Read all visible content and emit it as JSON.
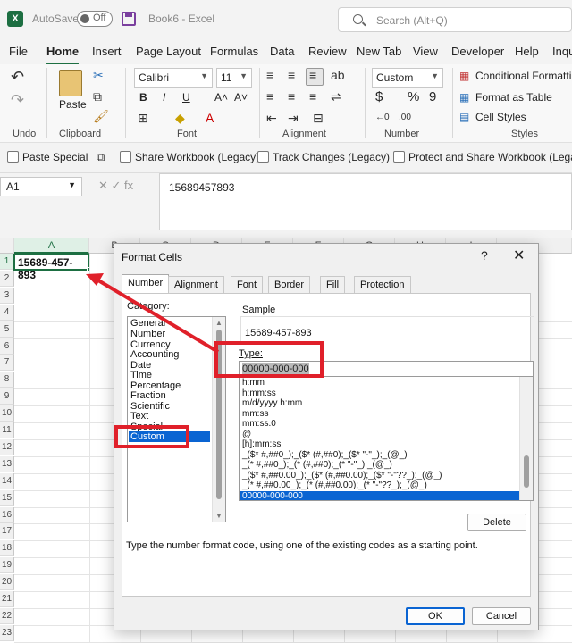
{
  "titlebar": {
    "logo": "X",
    "autosave_label": "AutoSave",
    "autosave_state": "Off",
    "document_title": "Book6  -  Excel",
    "search_placeholder": "Search (Alt+Q)"
  },
  "ribbon_tabs": [
    "File",
    "Home",
    "Insert",
    "Page Layout",
    "Formulas",
    "Data",
    "Review",
    "New Tab",
    "View",
    "Developer",
    "Help",
    "Inqu"
  ],
  "ribbon": {
    "groups": {
      "undo": "Undo",
      "clipboard": "Clipboard",
      "font": "Font",
      "alignment": "Alignment",
      "number": "Number",
      "styles": "Styles"
    },
    "paste_label": "Paste",
    "font_name": "Calibri",
    "font_size": "11",
    "number_format": "Custom",
    "conditional_formatting": "Conditional Formatting",
    "format_as_table": "Format as Table",
    "cell_styles": "Cell Styles",
    "bold": "B",
    "italic": "I",
    "underline": "U",
    "font_grow": "A˄",
    "font_shrink": "A˅",
    "currency": "$",
    "percent": "%",
    "comma": "9"
  },
  "quick_access": [
    "Paste Special",
    "Share Workbook (Legacy)",
    "Track Changes (Legacy)",
    "Protect and Share Workbook (Legacy)"
  ],
  "formula_bar": {
    "name_box": "A1",
    "icons": "✕  ✓  fx",
    "value": "15689457893"
  },
  "grid": {
    "columns": [
      "A",
      "B",
      "C",
      "D",
      "E",
      "F",
      "G",
      "H",
      "I"
    ],
    "rows": [
      "1",
      "2",
      "3",
      "4",
      "5",
      "6",
      "7",
      "8",
      "9",
      "10",
      "11",
      "12",
      "13",
      "14",
      "15",
      "16",
      "17",
      "18",
      "19",
      "20",
      "21",
      "22",
      "23"
    ],
    "a1_display": "15689-457-893"
  },
  "dialog": {
    "title": "Format Cells",
    "help": "?",
    "close": "✕",
    "tabs": [
      "Number",
      "Alignment",
      "Font",
      "Border",
      "Fill",
      "Protection"
    ],
    "category_label": "Category:",
    "categories": [
      "General",
      "Number",
      "Currency",
      "Accounting",
      "Date",
      "Time",
      "Percentage",
      "Fraction",
      "Scientific",
      "Text",
      "Special",
      "Custom"
    ],
    "selected_category": "Custom",
    "sample_label": "Sample",
    "sample_value": "15689-457-893",
    "type_label": "Type:",
    "type_value": "00000-000-000",
    "formats": [
      "h:mm",
      "h:mm:ss",
      "m/d/yyyy h:mm",
      "mm:ss",
      "mm:ss.0",
      "@",
      "[h]:mm:ss",
      "_($* #,##0_);_($* (#,##0);_($* \"-\"_);_(@_)",
      "_(* #,##0_);_(* (#,##0);_(* \"-\"_);_(@_)",
      "_($* #,##0.00_);_($* (#,##0.00);_($* \"-\"??_);_(@_)",
      "_(* #,##0.00_);_(* (#,##0.00);_(* \"-\"??_);_(@_)",
      "00000-000-000"
    ],
    "delete_button": "Delete",
    "help_text": "Type the number format code, using one of the existing codes as a starting point.",
    "ok_button": "OK",
    "cancel_button": "Cancel"
  },
  "annotation": {
    "color": "#e0202a"
  }
}
